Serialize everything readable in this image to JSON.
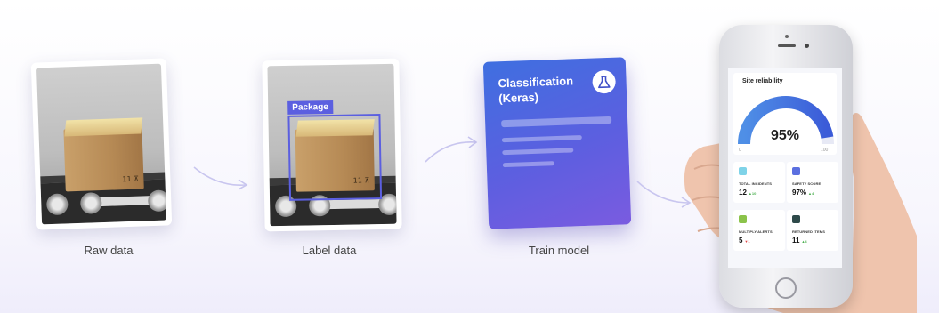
{
  "steps": [
    {
      "caption": "Raw data"
    },
    {
      "caption": "Label data"
    },
    {
      "caption": "Train model"
    }
  ],
  "box_marking": "11 ⊼",
  "label_tag": "Package",
  "model_card": {
    "title": "Classification (Keras)",
    "icon": "flask-icon"
  },
  "phone": {
    "title": "Site reliability",
    "gauge": {
      "value": "95%",
      "min": "0",
      "max": "100",
      "level": 0.95
    },
    "tiles": [
      {
        "label": "TOTAL INCIDENTS",
        "value": "12",
        "delta": "▲10",
        "delta_color": "#4caf50",
        "icon_color": "#7fd3e8"
      },
      {
        "label": "SAFETY SCORE",
        "value": "97%",
        "delta": "▲4",
        "delta_color": "#4caf50",
        "icon_color": "#5b6fe0"
      },
      {
        "label": "MULTIPLY ALERTS",
        "value": "5",
        "delta": "▼1",
        "delta_color": "#e04848",
        "icon_color": "#8bc34a"
      },
      {
        "label": "RETURNED ITEMS",
        "value": "11",
        "delta": "▲4",
        "delta_color": "#4caf50",
        "icon_color": "#2e4a4a"
      }
    ]
  },
  "colors": {
    "accent": "#5b5fe0",
    "gauge_start": "#4f8fe6",
    "gauge_end": "#3b5bd8"
  }
}
